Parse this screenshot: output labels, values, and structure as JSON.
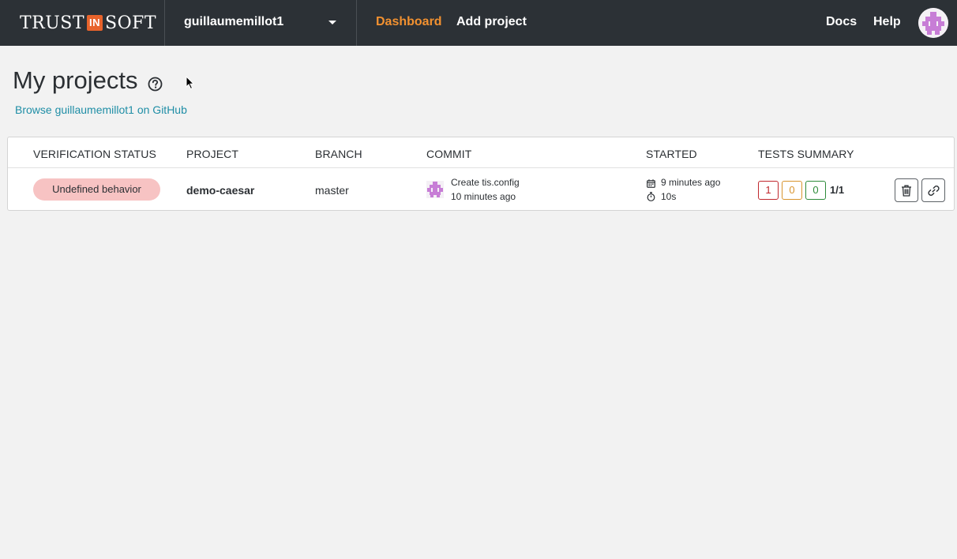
{
  "brand": {
    "left": "TRUST",
    "badge": "IN",
    "right": "SOFT",
    "badge_color": "#e8632b"
  },
  "header": {
    "organization": "guillaumemillot1",
    "nav": {
      "dashboard": "Dashboard",
      "add_project": "Add project"
    },
    "right_links": {
      "docs": "Docs",
      "help": "Help"
    },
    "avatar_icon": "user-identicon"
  },
  "page": {
    "title": "My projects",
    "help_icon": "question-circle-icon",
    "github_link": "Browse guillaumemillot1 on GitHub"
  },
  "table": {
    "columns": [
      "VERIFICATION STATUS",
      "PROJECT",
      "BRANCH",
      "COMMIT",
      "STARTED",
      "TESTS SUMMARY"
    ],
    "rows": [
      {
        "status": "Undefined behavior",
        "project": "demo-caesar",
        "branch": "master",
        "commit_message": "Create tis.config",
        "commit_time": "10 minutes ago",
        "started": "9 minutes ago",
        "duration": "10s",
        "tests": {
          "red": "1",
          "orange": "0",
          "green": "0",
          "ratio": "1/1"
        },
        "actions": [
          "trash-icon",
          "link-icon"
        ]
      }
    ]
  },
  "colors": {
    "topbar": "#2c3136",
    "accent": "#f29130",
    "link": "#1f8ea6",
    "status_undefined_bg": "#f7c3c3",
    "test_red": "#c0282d",
    "test_orange": "#d8942e",
    "test_green": "#2e8b3a"
  }
}
